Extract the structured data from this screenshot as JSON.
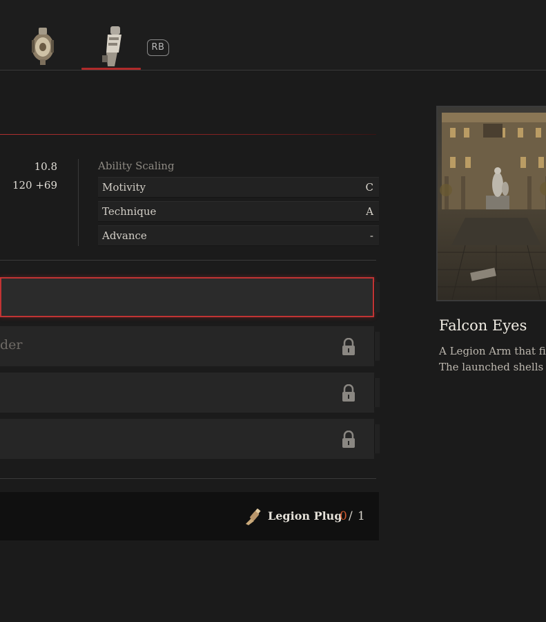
{
  "top_bar": {
    "tabs": [
      {
        "icon": "legion-arm-shield-icon"
      },
      {
        "icon": "legion-arm-flamethrower-icon"
      }
    ],
    "rb_label": "RB",
    "accent_color": "#b02a2a"
  },
  "stats": {
    "values": [
      "10.8",
      "120 +69"
    ]
  },
  "ability_scaling": {
    "title": "Ability Scaling",
    "rows": [
      {
        "label": "Motivity",
        "grade": "C"
      },
      {
        "label": "Technique",
        "grade": "A"
      },
      {
        "label": "Advance",
        "grade": "-"
      }
    ]
  },
  "slots": [
    {
      "text": "",
      "locked": false,
      "selected": true
    },
    {
      "text": "der",
      "locked": true,
      "selected": false
    },
    {
      "text": "",
      "locked": true,
      "selected": false
    },
    {
      "text": "",
      "locked": true,
      "selected": false
    }
  ],
  "requirement": {
    "icon": "legion-plug-icon",
    "label": "Legion Plug",
    "have": "0",
    "separator": "/",
    "need": "1",
    "have_color": "#d35a2e"
  },
  "preview": {
    "title": "Falcon Eyes",
    "description_lines": [
      "A Legion Arm that fires",
      "The launched shells exp"
    ]
  }
}
